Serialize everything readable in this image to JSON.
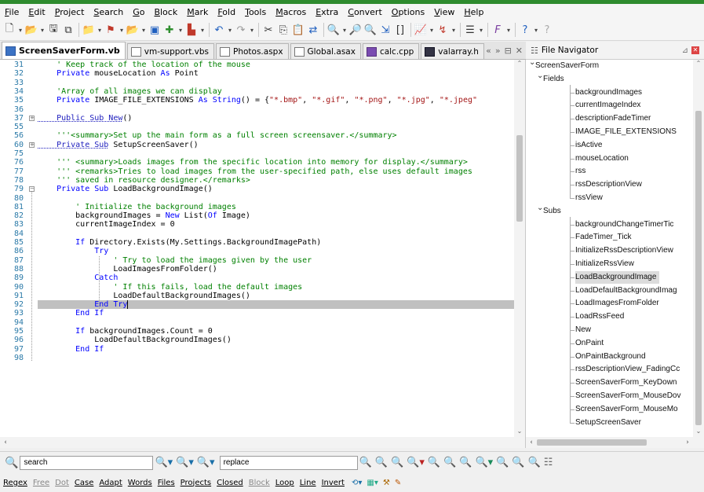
{
  "menu": [
    "File",
    "Edit",
    "Project",
    "Search",
    "Go",
    "Block",
    "Mark",
    "Fold",
    "Tools",
    "Macros",
    "Extra",
    "Convert",
    "Options",
    "View",
    "Help"
  ],
  "tabs": [
    {
      "label": "ScreenSaverForm.vb",
      "icon": "vb",
      "active": true
    },
    {
      "label": "vm-support.vbs",
      "icon": "vbs",
      "active": false
    },
    {
      "label": "Photos.aspx",
      "icon": "page",
      "active": false
    },
    {
      "label": "Global.asax",
      "icon": "page",
      "active": false
    },
    {
      "label": "calc.cpp",
      "icon": "cpp",
      "active": false
    },
    {
      "label": "valarray.h",
      "icon": "h",
      "active": false
    }
  ],
  "tab_nav": {
    "scroll": "«",
    "more": "»",
    "list": "⊟",
    "close": "✕"
  },
  "navigator": {
    "title": "File Navigator",
    "pin": "⊿",
    "root": "ScreenSaverForm",
    "groups": [
      {
        "name": "Fields",
        "items": [
          "backgroundImages",
          "currentImageIndex",
          "descriptionFadeTimer",
          "IMAGE_FILE_EXTENSIONS",
          "isActive",
          "mouseLocation",
          "rss",
          "rssDescriptionView",
          "rssView"
        ]
      },
      {
        "name": "Subs",
        "items": [
          "backgroundChangeTimerTic",
          "FadeTimer_Tick",
          "InitializeRssDescriptionView",
          "InitializeRssView",
          "LoadBackgroundImage",
          "LoadDefaultBackgroundImag",
          "LoadImagesFromFolder",
          "LoadRssFeed",
          "New",
          "OnPaint",
          "OnPaintBackground",
          "rssDescriptionView_FadingCc",
          "ScreenSaverForm_KeyDown",
          "ScreenSaverForm_MouseDov",
          "ScreenSaverForm_MouseMo",
          "SetupScreenSaver"
        ]
      }
    ],
    "selected": "LoadBackgroundImage"
  },
  "code": {
    "current_line": "92",
    "lines": [
      {
        "n": "31",
        "fold": "",
        "segs": [
          [
            "c",
            "    ' Keep track of the location of the mouse"
          ]
        ]
      },
      {
        "n": "32",
        "fold": "",
        "segs": [
          [
            "k",
            "    Private"
          ],
          [
            "t",
            " mouseLocation "
          ],
          [
            "k",
            "As"
          ],
          [
            "t",
            " Point"
          ]
        ]
      },
      {
        "n": "33",
        "fold": "",
        "segs": []
      },
      {
        "n": "34",
        "fold": "",
        "segs": [
          [
            "c",
            "    'Array of all images we can display"
          ]
        ]
      },
      {
        "n": "35",
        "fold": "",
        "segs": [
          [
            "k",
            "    Private"
          ],
          [
            "t",
            " IMAGE_FILE_EXTENSIONS "
          ],
          [
            "k",
            "As String"
          ],
          [
            "t",
            "() = {"
          ],
          [
            "s",
            "\"*.bmp\""
          ],
          [
            "t",
            ", "
          ],
          [
            "s",
            "\"*.gif\""
          ],
          [
            "t",
            ", "
          ],
          [
            "s",
            "\"*.png\""
          ],
          [
            "t",
            ", "
          ],
          [
            "s",
            "\"*.jpg\""
          ],
          [
            "t",
            ", "
          ],
          [
            "s",
            "\"*.jpeg\""
          ]
        ]
      },
      {
        "n": "36",
        "fold": "",
        "segs": []
      },
      {
        "n": "37",
        "fold": "+",
        "segs": [
          [
            "d",
            "    Public Sub New"
          ],
          [
            "t",
            "()"
          ]
        ]
      },
      {
        "n": "55",
        "fold": "",
        "segs": []
      },
      {
        "n": "56",
        "fold": "",
        "segs": [
          [
            "c",
            "    '''<summary>Set up the main form as a full screen screensaver.</summary>"
          ]
        ]
      },
      {
        "n": "60",
        "fold": "+",
        "segs": [
          [
            "d",
            "    Private Sub"
          ],
          [
            "t",
            " SetupScreenSaver()"
          ]
        ]
      },
      {
        "n": "75",
        "fold": "",
        "segs": []
      },
      {
        "n": "76",
        "fold": "",
        "segs": [
          [
            "c",
            "    ''' <summary>Loads images from the specific location into memory for display.</summary>"
          ]
        ]
      },
      {
        "n": "77",
        "fold": "",
        "segs": [
          [
            "c",
            "    ''' <remarks>Tries to load images from the user-specified path, else uses default images"
          ]
        ]
      },
      {
        "n": "78",
        "fold": "",
        "segs": [
          [
            "c",
            "    ''' saved in resource designer.</remarks>"
          ]
        ]
      },
      {
        "n": "79",
        "fold": "-",
        "segs": [
          [
            "k",
            "    Private Sub"
          ],
          [
            "t",
            " LoadBackgroundImage()"
          ]
        ]
      },
      {
        "n": "80",
        "fold": "",
        "segs": []
      },
      {
        "n": "81",
        "fold": "",
        "segs": [
          [
            "c",
            "        ' Initialize the background images"
          ]
        ]
      },
      {
        "n": "82",
        "fold": "",
        "segs": [
          [
            "t",
            "        backgroundImages = "
          ],
          [
            "k",
            "New"
          ],
          [
            "t",
            " List("
          ],
          [
            "k",
            "Of"
          ],
          [
            "t",
            " Image)"
          ]
        ]
      },
      {
        "n": "83",
        "fold": "",
        "segs": [
          [
            "t",
            "        currentImageIndex = 0"
          ]
        ]
      },
      {
        "n": "84",
        "fold": "",
        "segs": []
      },
      {
        "n": "85",
        "fold": "",
        "segs": [
          [
            "k",
            "        If"
          ],
          [
            "t",
            " Directory.Exists(My.Settings.BackgroundImagePath)"
          ]
        ]
      },
      {
        "n": "86",
        "fold": "",
        "segs": [
          [
            "k",
            "            Try"
          ]
        ]
      },
      {
        "n": "87",
        "fold": "",
        "segs": [
          [
            "c",
            "                ' Try to load the images given by the user"
          ]
        ]
      },
      {
        "n": "88",
        "fold": "",
        "segs": [
          [
            "t",
            "                LoadImagesFromFolder()"
          ]
        ]
      },
      {
        "n": "89",
        "fold": "",
        "segs": [
          [
            "k",
            "            Catch"
          ]
        ]
      },
      {
        "n": "90",
        "fold": "",
        "segs": [
          [
            "c",
            "                ' If this fails, load the default images"
          ]
        ]
      },
      {
        "n": "91",
        "fold": "",
        "segs": [
          [
            "t",
            "                LoadDefaultBackgroundImages()"
          ]
        ]
      },
      {
        "n": "92",
        "fold": "",
        "segs": [
          [
            "k",
            "            End Try"
          ]
        ]
      },
      {
        "n": "93",
        "fold": "",
        "segs": [
          [
            "k",
            "        End If"
          ]
        ]
      },
      {
        "n": "94",
        "fold": "",
        "segs": []
      },
      {
        "n": "95",
        "fold": "",
        "segs": [
          [
            "k",
            "        If"
          ],
          [
            "t",
            " backgroundImages.Count = 0"
          ]
        ]
      },
      {
        "n": "96",
        "fold": "",
        "segs": [
          [
            "t",
            "            LoadDefaultBackgroundImages()"
          ]
        ]
      },
      {
        "n": "97",
        "fold": "",
        "segs": [
          [
            "k",
            "        End If"
          ]
        ]
      },
      {
        "n": "98",
        "fold": "",
        "segs": []
      }
    ]
  },
  "search": {
    "find_value": "search",
    "replace_value": "replace"
  },
  "options": [
    {
      "label": "Regex",
      "dim": false
    },
    {
      "label": "Free",
      "dim": true
    },
    {
      "label": "Dot",
      "dim": true
    },
    {
      "label": "Case",
      "dim": false
    },
    {
      "label": "Adapt",
      "dim": false
    },
    {
      "label": "Words",
      "dim": false
    },
    {
      "label": "Files",
      "dim": false
    },
    {
      "label": "Projects",
      "dim": false
    },
    {
      "label": "Closed",
      "dim": false
    },
    {
      "label": "Block",
      "dim": true
    },
    {
      "label": "Loop",
      "dim": false
    },
    {
      "label": "Line",
      "dim": false
    },
    {
      "label": "Invert",
      "dim": false
    }
  ],
  "colors": {
    "keyword": "#0000ff",
    "comment": "#008000",
    "string": "#a31515",
    "line_number": "#2b7aa8",
    "current_line": "#c0c0c0",
    "accent": "#2e8b2e"
  }
}
